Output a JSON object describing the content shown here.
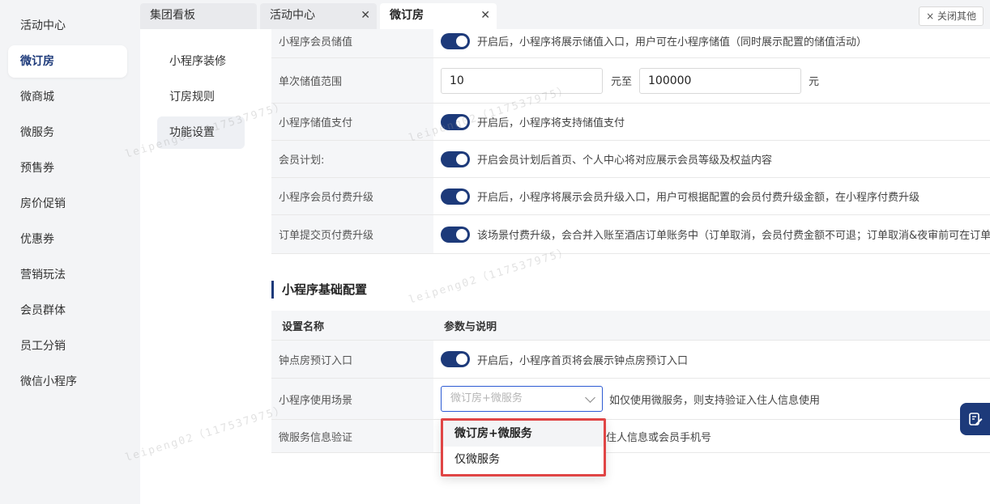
{
  "left_nav": {
    "items": [
      {
        "label": "活动中心"
      },
      {
        "label": "微订房"
      },
      {
        "label": "微商城"
      },
      {
        "label": "微服务"
      },
      {
        "label": "预售券"
      },
      {
        "label": "房价促销"
      },
      {
        "label": "优惠券"
      },
      {
        "label": "营销玩法"
      },
      {
        "label": "会员群体"
      },
      {
        "label": "员工分销"
      },
      {
        "label": "微信小程序"
      }
    ],
    "active": "微订房"
  },
  "tabs": {
    "items": [
      {
        "label": "集团看板"
      },
      {
        "label": "活动中心"
      },
      {
        "label": "微订房"
      }
    ],
    "close_others_label": "× 关闭其他"
  },
  "sub_menu": {
    "items": [
      {
        "label": "小程序装修"
      },
      {
        "label": "订房规则"
      },
      {
        "label": "功能设置"
      }
    ]
  },
  "member_settings": {
    "rows": [
      {
        "name": "小程序会员储值",
        "desc": "开启后，小程序将展示储值入口，用户可在小程序储值（同时展示配置的储值活动）"
      },
      {
        "name": "单次储值范围",
        "min_value": "10",
        "sep": "元至",
        "max_value": "100000",
        "unit": "元"
      },
      {
        "name": "小程序储值支付",
        "desc": "开启后，小程序将支持储值支付"
      },
      {
        "name": "会员计划:",
        "desc": "开启会员计划后首页、个人中心将对应展示会员等级及权益内容"
      },
      {
        "name": "小程序会员付费升级",
        "desc": "开启后，小程序将展示会员升级入口，用户可根据配置的会员付费升级金额，在小程序付费升级"
      },
      {
        "name": "订单提交页付费升级",
        "desc": "该场景付费升级，会合并入账至酒店订单账务中（订单取消，会员付费金额不可退；订单取消&夜审前可在订单"
      }
    ]
  },
  "basic_config": {
    "title": "小程序基础配置",
    "header": {
      "name": "设置名称",
      "desc": "参数与说明"
    },
    "rows": [
      {
        "name": "钟点房预订入口",
        "desc": "开启后，小程序首页将会展示钟点房预订入口"
      },
      {
        "name": "小程序使用场景",
        "select_value": "微订房+微服务",
        "desc": "如仅使用微服务，则支持验证入住人信息使用"
      },
      {
        "name": "微服务信息验证",
        "desc": "住人信息或会员手机号"
      }
    ]
  },
  "dropdown": {
    "options": [
      {
        "label": "微订房+微服务"
      },
      {
        "label": "仅微服务"
      }
    ]
  },
  "watermark": "leipeng02（117537975）",
  "colors": {
    "accent": "#1d3a7a",
    "highlight_border": "#e04545"
  }
}
